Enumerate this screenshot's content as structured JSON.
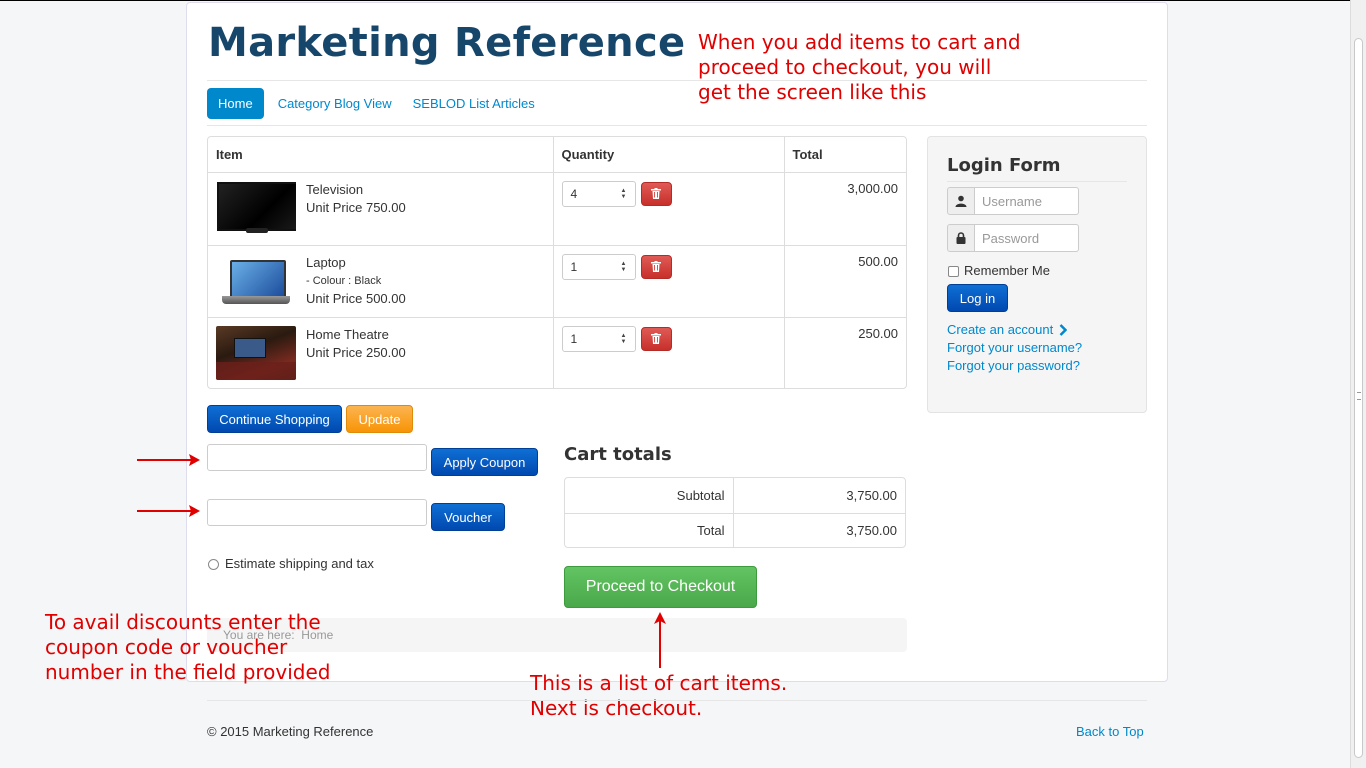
{
  "site": {
    "brand": "Marketing Reference"
  },
  "nav": {
    "items": [
      "Home",
      "Category Blog View",
      "SEBLOD List Articles"
    ]
  },
  "cart": {
    "headers": {
      "item": "Item",
      "quantity": "Quantity",
      "total": "Total"
    },
    "items": [
      {
        "name": "Television",
        "option": "",
        "unit_price": "Unit Price 750.00",
        "qty": "4",
        "total": "3,000.00"
      },
      {
        "name": "Laptop",
        "option": "- Colour : Black",
        "unit_price": "Unit Price 500.00",
        "qty": "1",
        "total": "500.00"
      },
      {
        "name": "Home Theatre",
        "option": "",
        "unit_price": "Unit Price 250.00",
        "qty": "1",
        "total": "250.00"
      }
    ],
    "continue_label": "Continue Shopping",
    "update_label": "Update",
    "coupon_label": "Apply Coupon",
    "voucher_label": "Voucher",
    "estimate_label": "Estimate shipping and tax"
  },
  "totals": {
    "title": "Cart totals",
    "subtotal_label": "Subtotal",
    "subtotal_value": "3,750.00",
    "total_label": "Total",
    "total_value": "3,750.00",
    "checkout_label": "Proceed to Checkout"
  },
  "breadcrumb": {
    "prefix": "You are here:",
    "current": "Home"
  },
  "login": {
    "title": "Login Form",
    "username_placeholder": "Username",
    "password_placeholder": "Password",
    "remember_label": "Remember Me",
    "login_label": "Log in",
    "create_account": "Create an account",
    "forgot_username": "Forgot your username?",
    "forgot_password": "Forgot your password?"
  },
  "footer": {
    "copyright": "© 2015 Marketing Reference",
    "back_to_top": "Back to Top"
  },
  "annotations": {
    "top": [
      "When you add items to cart and",
      "proceed to checkout, you will",
      "get the screen like this"
    ],
    "left": [
      "To avail discounts enter the",
      "coupon code or voucher",
      "number in the field provided"
    ],
    "bottom": [
      "This is a list of cart items.",
      "Next is checkout."
    ]
  },
  "colors": {
    "brand": "#17466b",
    "link": "#0088cc",
    "annotation": "#e00000",
    "checkout": "#5cb85c",
    "danger": "#d9534f",
    "warning": "#f89406"
  }
}
